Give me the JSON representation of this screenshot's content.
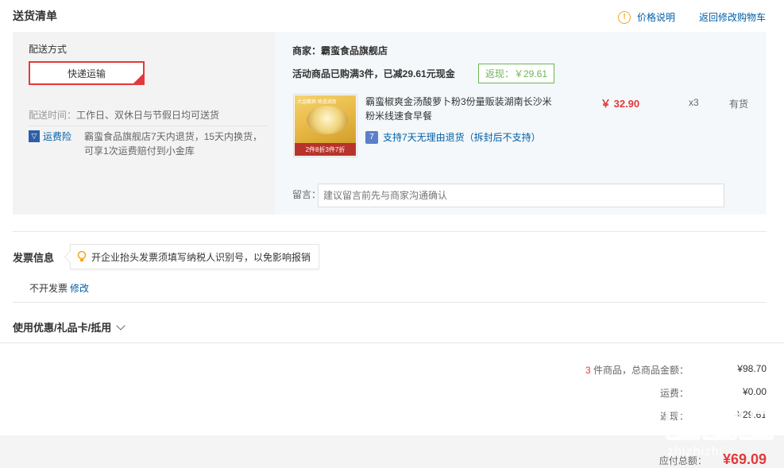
{
  "header": {
    "title": "送货清单",
    "price_help": "价格说明",
    "back_to_cart": "返回修改购物车",
    "info_glyph": "!"
  },
  "shipping": {
    "label": "配送方式",
    "method": "快递运输",
    "time_label": "配送时间：",
    "time_value": "工作日、双休日与节假日均可送货",
    "insurance_label": "运费险",
    "insurance_desc": "霸蛮食品旗舰店7天内退货，15天内换货，可享1次运费赔付到小金库"
  },
  "order": {
    "merchant": "商家：霸蛮食品旗舰店",
    "promo": "活动商品已购满3件，已减29.61元现金",
    "rebate": "返现：￥29.61",
    "product": {
      "name": "霸蛮椒爽金汤酸萝卜粉3份量贩装湖南长沙米粉米线速食早餐",
      "price": "￥ 32.90",
      "qty": "x3",
      "stock": "有货",
      "image_band": "2件8折3件7折",
      "image_top": "大金酸爽 地道湖南"
    },
    "return_policy": "支持7天无理由退货（拆封后不支持）",
    "message_label": "留言：",
    "message_placeholder": "建议留言前先与商家沟通确认"
  },
  "invoice": {
    "title": "发票信息",
    "tip": "开企业抬头发票须填写纳税人识别号，以免影响报销",
    "state": "不开发票",
    "modify": "修改"
  },
  "coupon": {
    "label": "使用优惠/礼品卡/抵用"
  },
  "summary": {
    "count": "3",
    "total_label": "件商品，总商品金额：",
    "total": "¥98.70",
    "freight_label": "运费：",
    "freight": "¥0.00",
    "rebate_label": "返现：",
    "rebate": "-¥29.61",
    "payable_label": "应付总额：",
    "payable": "¥69.09"
  },
  "watermark": {
    "text": "zhizhizhi"
  },
  "colors": {
    "accent_red": "#e4393c",
    "link_blue": "#005ea7",
    "rebate_green": "#6fb556",
    "warn_orange": "#f5a623"
  }
}
